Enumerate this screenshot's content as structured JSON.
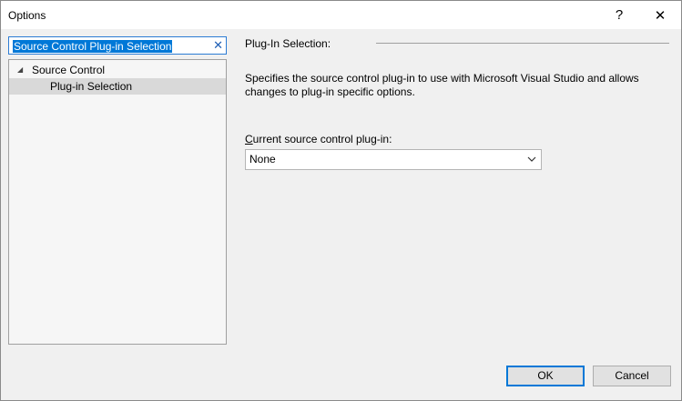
{
  "window": {
    "title": "Options",
    "help_glyph": "?",
    "close_glyph": "✕"
  },
  "search": {
    "value": "Source Control Plug-in Selection",
    "clear_glyph": "✕"
  },
  "tree": {
    "root": {
      "label": "Source Control",
      "expander_glyph": "◢"
    },
    "child": {
      "label": "Plug-in Selection",
      "selected": true
    }
  },
  "panel": {
    "header": "Plug-In Selection:",
    "description": "Specifies the source control plug-in to use with Microsoft Visual Studio and allows changes to plug-in specific options.",
    "field_label_access_key": "C",
    "field_label_rest": "urrent source control plug-in:",
    "dropdown_value": "None"
  },
  "buttons": {
    "ok": "OK",
    "cancel": "Cancel"
  },
  "colors": {
    "accent": "#0078d7",
    "selection_bg": "#d9d9d9",
    "dialog_bg": "#f0f0f0"
  }
}
